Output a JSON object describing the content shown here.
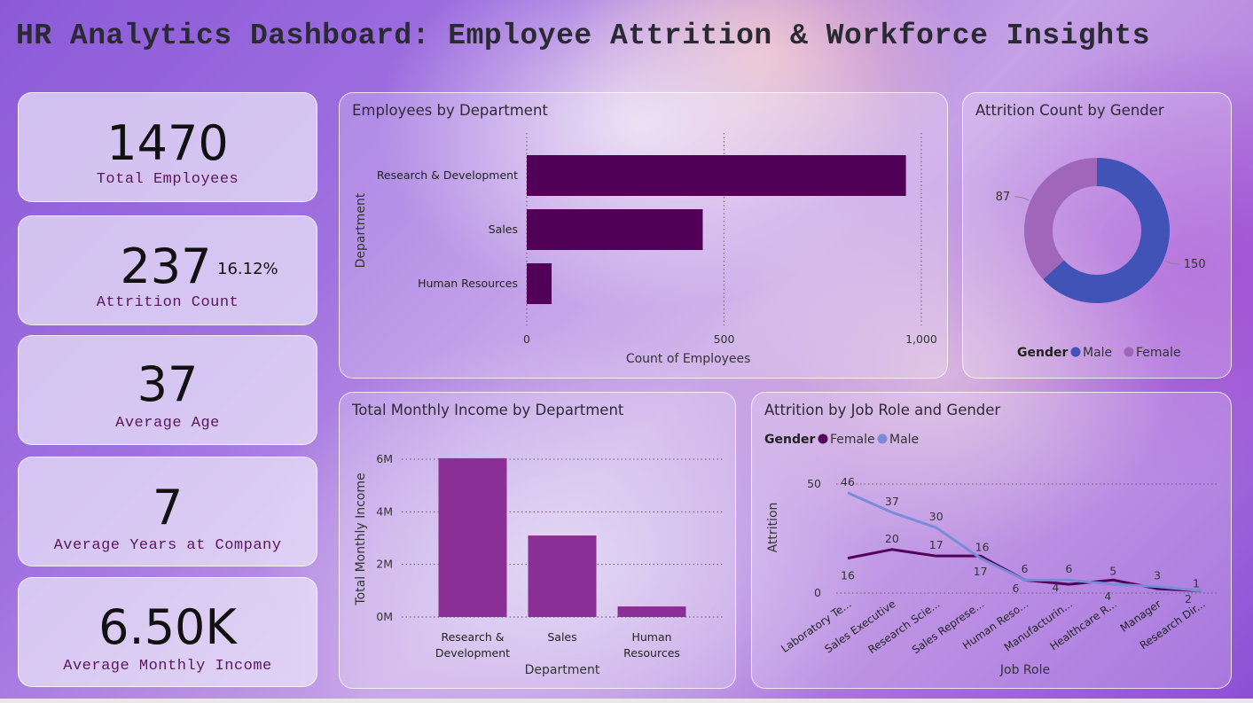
{
  "title": "HR Analytics Dashboard: Employee Attrition & Workforce Insights",
  "kpis": {
    "total_employees": {
      "value": "1470",
      "label": "Total Employees"
    },
    "attrition": {
      "value": "237",
      "rate": "16.12%",
      "label": "Attrition Count"
    },
    "average_age": {
      "value": "37",
      "label": "Average Age"
    },
    "average_years": {
      "value": "7",
      "label": "Average Years at Company"
    },
    "average_income": {
      "value": "6.50K",
      "label": "Average Monthly Income"
    }
  },
  "panels": {
    "dept": "Employees by Department",
    "gender": "Attrition Count by Gender",
    "income": "Total Monthly Income by Department",
    "jobrole": "Attrition by Job Role and Gender"
  },
  "colors": {
    "bar_dept": "#520057",
    "bar_income": "#8a2f96",
    "male": "#4253b8",
    "female": "#a066b9",
    "line_female": "#52005a",
    "line_male": "#7a8cd8"
  },
  "chart_data": [
    {
      "id": "employees_by_department",
      "type": "bar",
      "orientation": "horizontal",
      "title": "Employees by Department",
      "xlabel": "Count of Employees",
      "ylabel": "Department",
      "categories": [
        "Research & Development",
        "Sales",
        "Human Resources"
      ],
      "values": [
        961,
        446,
        63
      ],
      "xlim": [
        0,
        1000
      ],
      "xticks": [
        "0",
        "500",
        "1,000"
      ],
      "grid": true
    },
    {
      "id": "attrition_by_gender",
      "type": "pie",
      "donut": true,
      "title": "Attrition Count by Gender",
      "legend_title": "Gender",
      "legend_position": "bottom",
      "categories": [
        "Male",
        "Female"
      ],
      "values": [
        150,
        87
      ]
    },
    {
      "id": "income_by_department",
      "type": "bar",
      "title": "Total Monthly Income by Department",
      "xlabel": "Department",
      "ylabel": "Total Monthly Income",
      "categories": [
        "Research & Development",
        "Sales",
        "Human Resources"
      ],
      "values": [
        6036864,
        3098756,
        401618
      ],
      "ylim": [
        0,
        6000000
      ],
      "yticks": [
        "0M",
        "2M",
        "4M",
        "6M"
      ],
      "grid": true
    },
    {
      "id": "attrition_by_job_role_gender",
      "type": "line",
      "title": "Attrition by Job Role and Gender",
      "xlabel": "Job Role",
      "ylabel": "Attrition",
      "legend_title": "Gender",
      "legend_position": "top-left",
      "categories": [
        "Laboratory Te...",
        "Sales Executive",
        "Research Scie...",
        "Sales Represe...",
        "Human Reso...",
        "Manufacturin...",
        "Healthcare R...",
        "Manager",
        "Research Dir..."
      ],
      "series": [
        {
          "name": "Female",
          "values": [
            16,
            20,
            17,
            17,
            6,
            4,
            6,
            2,
            1
          ],
          "labels": [
            "16",
            "20",
            "17",
            "17",
            "6",
            "",
            "",
            "",
            ""
          ]
        },
        {
          "name": "Male",
          "values": [
            46,
            37,
            30,
            16,
            6,
            6,
            4,
            3,
            1
          ],
          "labels": [
            "46",
            "37",
            "30",
            "16",
            "6",
            "6",
            "4",
            "3",
            "1"
          ]
        }
      ],
      "extra_labels": [
        "4",
        "5",
        "2"
      ],
      "ylim": [
        0,
        50
      ],
      "yticks": [
        "0",
        "50"
      ],
      "grid": true
    }
  ]
}
